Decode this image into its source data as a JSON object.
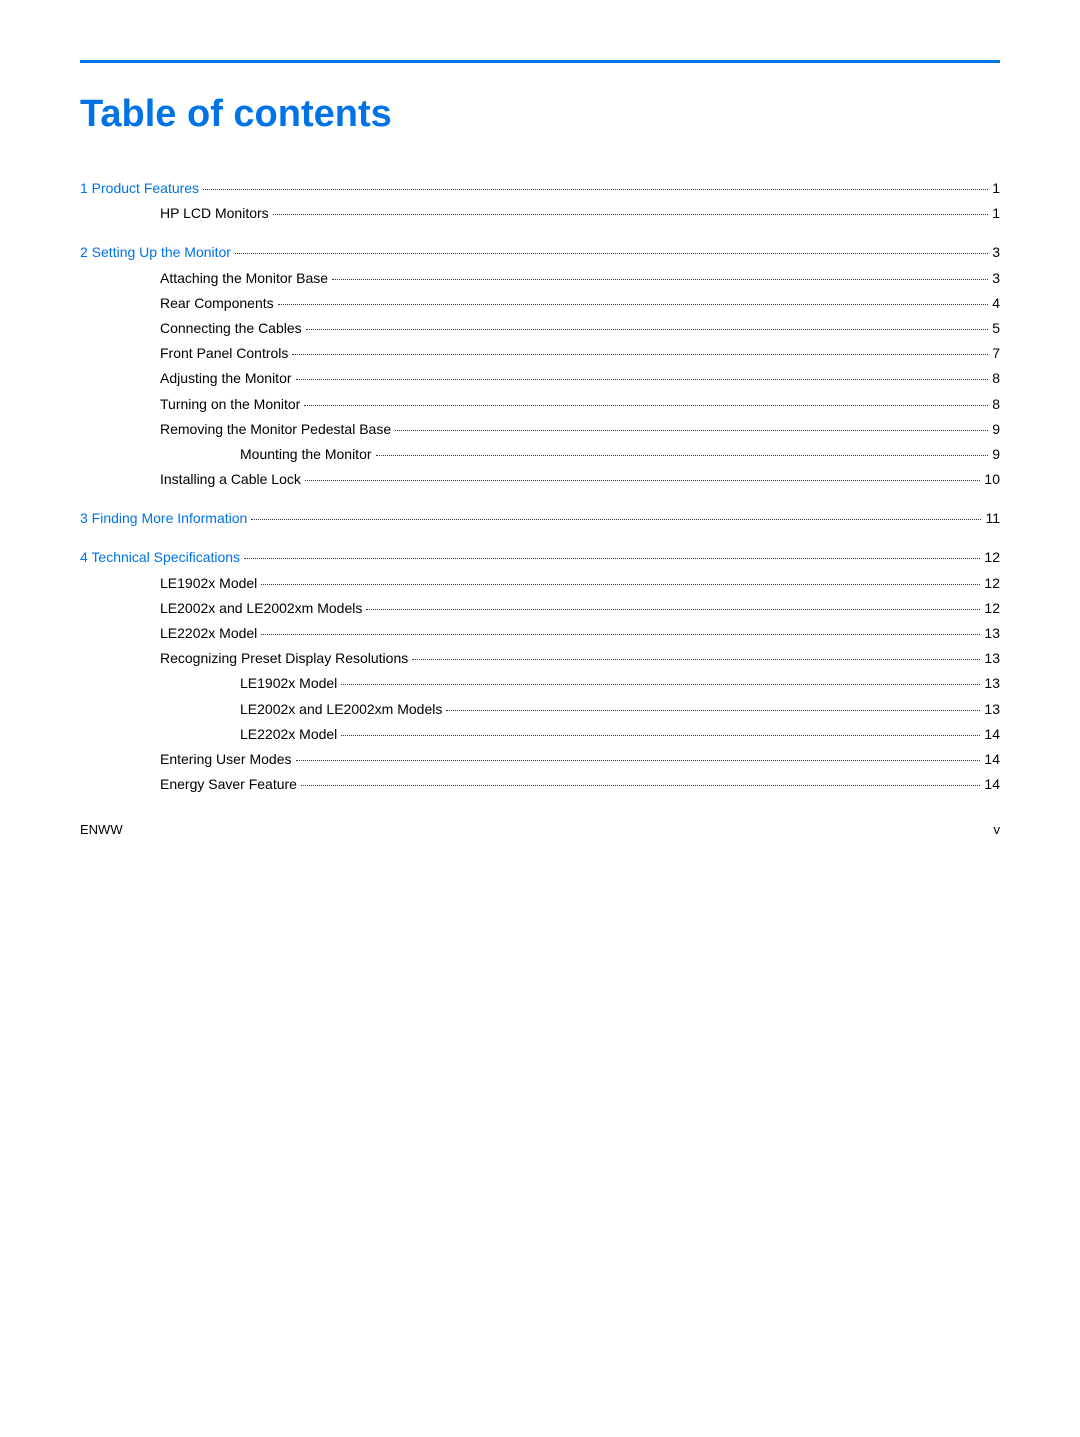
{
  "page": {
    "title": "Table of contents",
    "accent_color": "#0073e6",
    "footer_left": "ENWW",
    "footer_right": "v"
  },
  "toc": [
    {
      "id": "ch1",
      "indent": 0,
      "type": "chapter",
      "label": "1  Product Features",
      "color": "blue",
      "page": "1"
    },
    {
      "id": "ch1-s1",
      "indent": 1,
      "type": "section",
      "label": "HP LCD Monitors",
      "color": "black",
      "page": "1"
    },
    {
      "id": "spacer1",
      "type": "spacer"
    },
    {
      "id": "ch2",
      "indent": 0,
      "type": "chapter",
      "label": "2  Setting Up the Monitor",
      "color": "blue",
      "page": "3"
    },
    {
      "id": "ch2-s1",
      "indent": 1,
      "type": "section",
      "label": "Attaching the Monitor Base",
      "color": "black",
      "page": "3"
    },
    {
      "id": "ch2-s2",
      "indent": 1,
      "type": "section",
      "label": "Rear Components",
      "color": "black",
      "page": "4"
    },
    {
      "id": "ch2-s3",
      "indent": 1,
      "type": "section",
      "label": "Connecting the Cables",
      "color": "black",
      "page": "5"
    },
    {
      "id": "ch2-s4",
      "indent": 1,
      "type": "section",
      "label": "Front Panel Controls",
      "color": "black",
      "page": "7"
    },
    {
      "id": "ch2-s5",
      "indent": 1,
      "type": "section",
      "label": "Adjusting the Monitor",
      "color": "black",
      "page": "8"
    },
    {
      "id": "ch2-s6",
      "indent": 1,
      "type": "section",
      "label": "Turning on the Monitor",
      "color": "black",
      "page": "8"
    },
    {
      "id": "ch2-s7",
      "indent": 1,
      "type": "section",
      "label": "Removing the Monitor Pedestal Base",
      "color": "black",
      "page": "9"
    },
    {
      "id": "ch2-s7a",
      "indent": 2,
      "type": "section",
      "label": "Mounting the Monitor",
      "color": "black",
      "page": "9"
    },
    {
      "id": "ch2-s8",
      "indent": 1,
      "type": "section",
      "label": "Installing a Cable Lock",
      "color": "black",
      "page": "10"
    },
    {
      "id": "spacer2",
      "type": "spacer"
    },
    {
      "id": "ch3",
      "indent": 0,
      "type": "chapter",
      "label": "3  Finding More Information",
      "color": "blue",
      "page": "11"
    },
    {
      "id": "spacer3",
      "type": "spacer"
    },
    {
      "id": "ch4",
      "indent": 0,
      "type": "chapter",
      "label": "4  Technical Specifications",
      "color": "blue",
      "page": "12"
    },
    {
      "id": "ch4-s1",
      "indent": 1,
      "type": "section",
      "label": "LE1902x Model",
      "color": "black",
      "page": "12"
    },
    {
      "id": "ch4-s2",
      "indent": 1,
      "type": "section",
      "label": "LE2002x and LE2002xm Models",
      "color": "black",
      "page": "12"
    },
    {
      "id": "ch4-s3",
      "indent": 1,
      "type": "section",
      "label": "LE2202x Model",
      "color": "black",
      "page": "13"
    },
    {
      "id": "ch4-s4",
      "indent": 1,
      "type": "section",
      "label": "Recognizing Preset Display Resolutions",
      "color": "black",
      "page": "13"
    },
    {
      "id": "ch4-s4a",
      "indent": 2,
      "type": "section",
      "label": "LE1902x Model",
      "color": "black",
      "page": "13"
    },
    {
      "id": "ch4-s4b",
      "indent": 2,
      "type": "section",
      "label": "LE2002x and LE2002xm Models",
      "color": "black",
      "page": "13"
    },
    {
      "id": "ch4-s4c",
      "indent": 2,
      "type": "section",
      "label": "LE2202x Model",
      "color": "black",
      "page": "14"
    },
    {
      "id": "ch4-s5",
      "indent": 1,
      "type": "section",
      "label": "Entering User Modes",
      "color": "black",
      "page": "14"
    },
    {
      "id": "ch4-s6",
      "indent": 1,
      "type": "section",
      "label": "Energy Saver Feature",
      "color": "black",
      "page": "14"
    }
  ]
}
